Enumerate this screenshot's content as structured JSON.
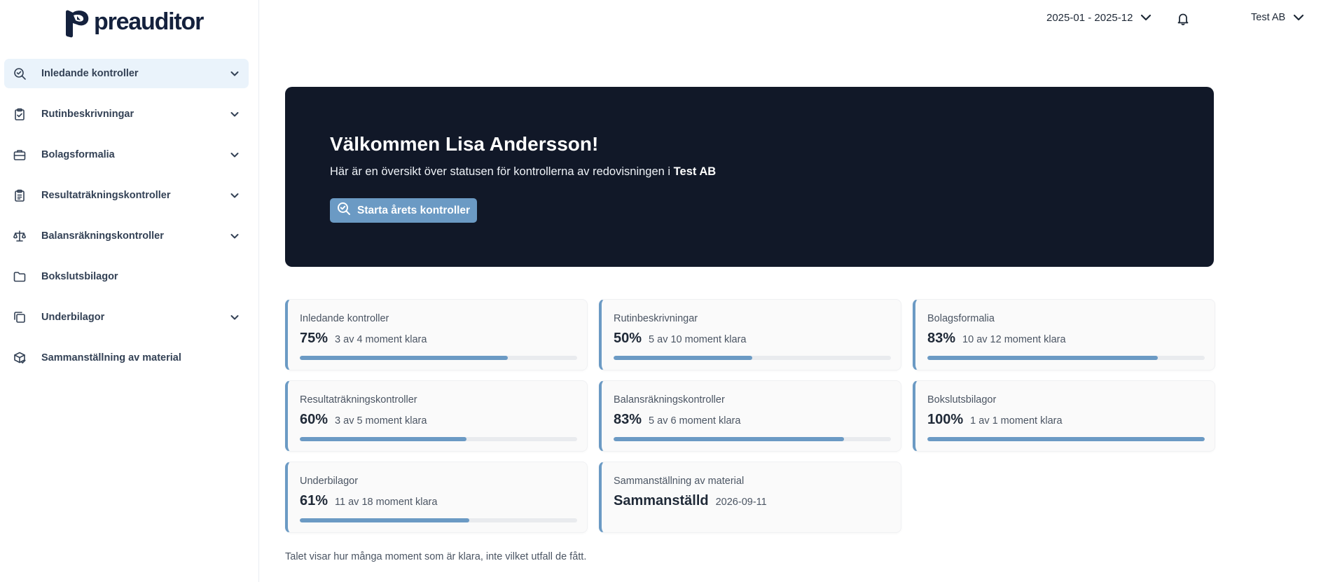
{
  "brand": {
    "name": "preauditor"
  },
  "header": {
    "period": "2025-01 - 2025-12",
    "company": "Test AB"
  },
  "sidebar": {
    "items": [
      {
        "label": "Inledande kontroller",
        "icon": "search-check-icon",
        "expandable": true,
        "active": true
      },
      {
        "label": "Rutinbeskrivningar",
        "icon": "clipboard-check-icon",
        "expandable": true,
        "active": false
      },
      {
        "label": "Bolagsformalia",
        "icon": "briefcase-icon",
        "expandable": true,
        "active": false
      },
      {
        "label": "Resultaträkningskontroller",
        "icon": "clipboard-list-icon",
        "expandable": true,
        "active": false
      },
      {
        "label": "Balansräkningskontroller",
        "icon": "scale-icon",
        "expandable": true,
        "active": false
      },
      {
        "label": "Bokslutsbilagor",
        "icon": "folder-icon",
        "expandable": false,
        "active": false
      },
      {
        "label": "Underbilagor",
        "icon": "copy-icon",
        "expandable": true,
        "active": false
      },
      {
        "label": "Sammanställning av material",
        "icon": "package-check-icon",
        "expandable": false,
        "active": false
      }
    ]
  },
  "hero": {
    "title": "Välkommen Lisa Andersson!",
    "subtitle_prefix": "Här är en översikt över statusen för kontrollerna av redovisningen i",
    "subtitle_company": "Test AB",
    "button_label": "Starta årets kontroller"
  },
  "cards": [
    {
      "title": "Inledande kontroller",
      "value": "75%",
      "detail": "3 av 4 moment klara",
      "progress": 0.75
    },
    {
      "title": "Rutinbeskrivningar",
      "value": "50%",
      "detail": "5 av 10 moment klara",
      "progress": 0.5
    },
    {
      "title": "Bolagsformalia",
      "value": "83%",
      "detail": "10 av 12 moment klara",
      "progress": 0.83
    },
    {
      "title": "Resultaträkningskontroller",
      "value": "60%",
      "detail": "3 av 5 moment klara",
      "progress": 0.6
    },
    {
      "title": "Balansräkningskontroller",
      "value": "83%",
      "detail": "5 av 6 moment klara",
      "progress": 0.83
    },
    {
      "title": "Bokslutsbilagor",
      "value": "100%",
      "detail": "1 av 1 moment klara",
      "progress": 1.0
    },
    {
      "title": "Underbilagor",
      "value": "61%",
      "detail": "11 av 18 moment klara",
      "progress": 0.61
    },
    {
      "title": "Sammanställning av material",
      "value": "Sammanställd",
      "detail": "2026-09-11",
      "progress": null
    }
  ],
  "footnote": "Talet visar hur många moment som är klara, inte vilket utfall de fått.",
  "colors": {
    "accent": "#6b9ac4",
    "hero_bg": "#111828",
    "active_nav_bg": "#eaf3fb",
    "brand_dark": "#14213d"
  }
}
